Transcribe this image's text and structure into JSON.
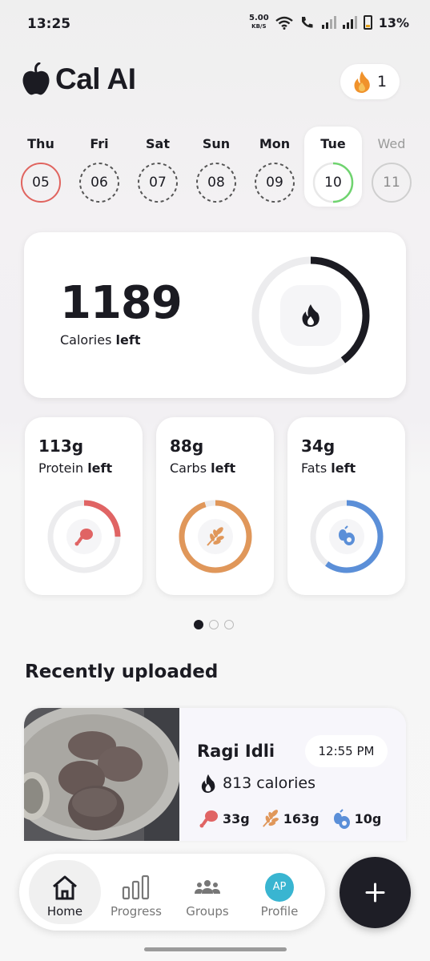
{
  "status_bar": {
    "time": "13:25",
    "net_speed_value": "5.00",
    "net_speed_unit": "KB/S",
    "battery": "13%"
  },
  "header": {
    "app_name": "Cal AI",
    "streak_count": "1"
  },
  "days": [
    {
      "label": "Thu",
      "number": "05",
      "state": "logged"
    },
    {
      "label": "Fri",
      "number": "06",
      "state": "empty"
    },
    {
      "label": "Sat",
      "number": "07",
      "state": "empty"
    },
    {
      "label": "Sun",
      "number": "08",
      "state": "empty"
    },
    {
      "label": "Mon",
      "number": "09",
      "state": "empty"
    },
    {
      "label": "Tue",
      "number": "10",
      "state": "selected"
    },
    {
      "label": "Wed",
      "number": "11",
      "state": "future"
    }
  ],
  "calories": {
    "value": "1189",
    "label_main": "Calories",
    "label_bold": "left",
    "progress": 0.4
  },
  "macros": [
    {
      "value": "113g",
      "name": "Protein",
      "suffix": "left",
      "progress": 0.25,
      "color": "#e06464",
      "icon": "drumstick-icon"
    },
    {
      "value": "88g",
      "name": "Carbs",
      "suffix": "left",
      "progress": 0.95,
      "color": "#e0975a",
      "icon": "wheat-icon"
    },
    {
      "value": "34g",
      "name": "Fats",
      "suffix": "left",
      "progress": 0.6,
      "color": "#5b8fd8",
      "icon": "avocado-icon"
    }
  ],
  "page_dots": {
    "count": 3,
    "active": 0
  },
  "recent": {
    "title": "Recently uploaded",
    "items": [
      {
        "name": "Ragi Idli",
        "time": "12:55 PM",
        "calories": "813 calories",
        "protein": "33g",
        "carbs": "163g",
        "fats": "10g"
      }
    ]
  },
  "nav": {
    "items": [
      {
        "label": "Home",
        "icon": "home-icon",
        "active": true
      },
      {
        "label": "Progress",
        "icon": "bar-chart-icon",
        "active": false
      },
      {
        "label": "Groups",
        "icon": "group-icon",
        "active": false
      },
      {
        "label": "Profile",
        "icon": "avatar",
        "active": false,
        "initials": "AP"
      }
    ]
  },
  "colors": {
    "accent_dark": "#1e1e26",
    "protein": "#e06464",
    "carbs": "#e0975a",
    "fats": "#5b8fd8",
    "streak_flame": "#f0922b",
    "today_ring": "#6fd46f",
    "logged_ring": "#e0645f"
  }
}
